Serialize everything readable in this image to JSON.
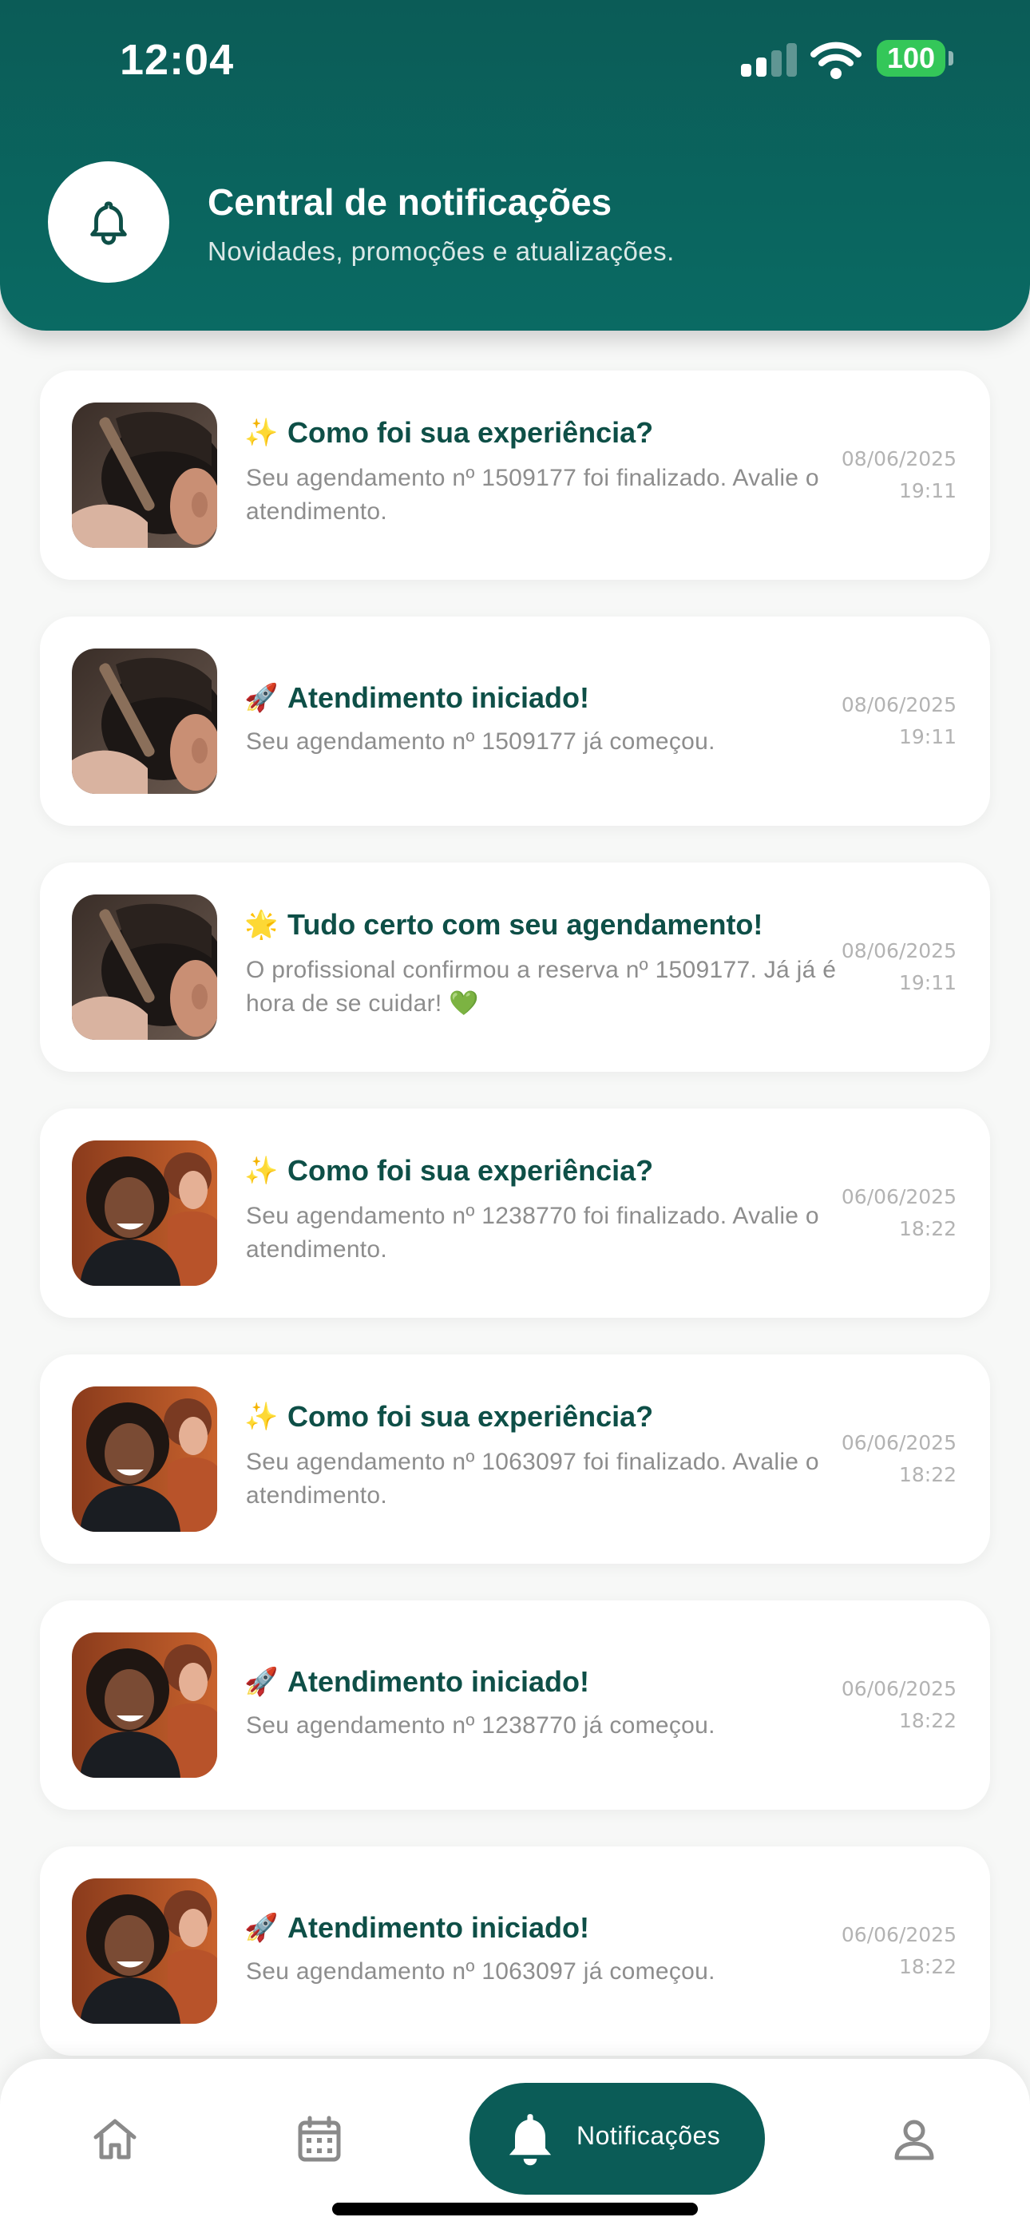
{
  "status_bar": {
    "time": "12:04",
    "battery": "100"
  },
  "header": {
    "title": "Central de notificações",
    "subtitle": "Novidades, promoções e atualizações."
  },
  "notifications": [
    {
      "emoji": "✨",
      "title": "Como foi sua experiência?",
      "body": "Seu agendamento nº 1509177 foi finalizado. Avalie o atendimento.",
      "date": "08/06/2025",
      "time": "19:11",
      "image": "barber-haircut-photo"
    },
    {
      "emoji": "🚀",
      "title": "Atendimento iniciado!",
      "body": "Seu agendamento nº 1509177 já começou.",
      "date": "08/06/2025",
      "time": "19:11",
      "image": "barber-haircut-photo"
    },
    {
      "emoji": "🌟",
      "title": "Tudo certo com seu agendamento!",
      "body": "O profissional confirmou a reserva nº 1509177. Já já é hora de se cuidar! 💚",
      "date": "08/06/2025",
      "time": "19:11",
      "image": "barber-haircut-photo"
    },
    {
      "emoji": "✨",
      "title": "Como foi sua experiência?",
      "body": "Seu agendamento nº 1238770 foi finalizado. Avalie o atendimento.",
      "date": "06/06/2025",
      "time": "18:22",
      "image": "salon-client-photo"
    },
    {
      "emoji": "✨",
      "title": "Como foi sua experiência?",
      "body": "Seu agendamento nº 1063097 foi finalizado. Avalie o atendimento.",
      "date": "06/06/2025",
      "time": "18:22",
      "image": "salon-client-photo"
    },
    {
      "emoji": "🚀",
      "title": "Atendimento iniciado!",
      "body": "Seu agendamento nº 1238770 já começou.",
      "date": "06/06/2025",
      "time": "18:22",
      "image": "salon-client-photo"
    },
    {
      "emoji": "🚀",
      "title": "Atendimento iniciado!",
      "body": "Seu agendamento nº 1063097 já começou.",
      "date": "06/06/2025",
      "time": "18:22",
      "image": "salon-client-photo"
    }
  ],
  "bottom_nav": {
    "items": [
      {
        "icon": "home-icon"
      },
      {
        "icon": "calendar-icon"
      },
      {
        "icon": "bell-icon",
        "label": "Notificações",
        "active": true
      },
      {
        "icon": "user-icon"
      }
    ]
  },
  "colors": {
    "brand": "#0b5c57",
    "title_text": "#0e4f47",
    "body_text": "#8d8d8d",
    "battery": "#34c759",
    "background": "#f7f8f7"
  }
}
